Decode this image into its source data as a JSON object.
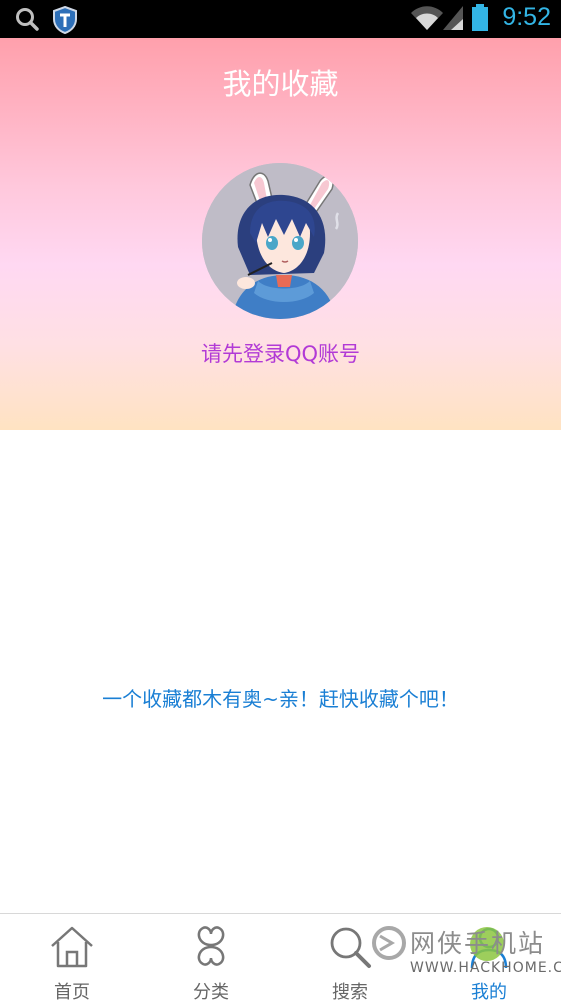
{
  "status_bar": {
    "time": "9:52",
    "icons": [
      "search-icon",
      "shield-app-icon",
      "wifi-icon",
      "signal-icon",
      "battery-icon"
    ],
    "time_color": "#33b5e5"
  },
  "header": {
    "title": "我的收藏",
    "login_prompt": "请先登录QQ账号",
    "gradient_colors": [
      "#ffa0ac",
      "#ffd8f2",
      "#ffe3c2"
    ]
  },
  "empty_state": {
    "message": "一个收藏都木有奥~亲！赶快收藏个吧！"
  },
  "bottom_nav": {
    "items": [
      {
        "label": "首页",
        "icon": "home-icon"
      },
      {
        "label": "分类",
        "icon": "clover-icon"
      },
      {
        "label": "搜索",
        "icon": "search-icon"
      },
      {
        "label": "我的",
        "icon": "person-icon",
        "active": true
      }
    ],
    "active_color": "#1a7fd4"
  },
  "watermark": {
    "text": "网侠手机站",
    "url": "WWW.HACKHOME.COM"
  }
}
